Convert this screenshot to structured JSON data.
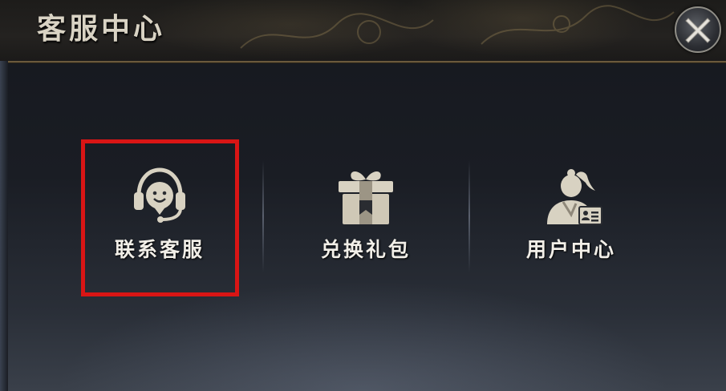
{
  "header": {
    "title": "客服中心",
    "close_icon": "close-x-icon"
  },
  "items": [
    {
      "label": "联系客服",
      "icon": "headset-icon",
      "highlighted": true
    },
    {
      "label": "兑换礼包",
      "icon": "gift-box-icon",
      "highlighted": false
    },
    {
      "label": "用户中心",
      "icon": "user-id-card-icon",
      "highlighted": false
    }
  ],
  "colors": {
    "highlight_border": "#d91515",
    "label_text": "#f2efe8",
    "icon_fill": "#d8d2c2",
    "header_border": "#6b5a3c"
  }
}
